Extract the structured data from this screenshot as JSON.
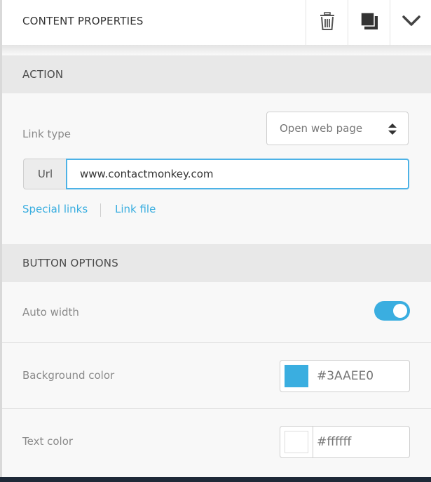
{
  "header": {
    "title": "CONTENT PROPERTIES",
    "icons": [
      "trash-icon",
      "duplicate-icon",
      "chevron-down-icon"
    ]
  },
  "action": {
    "section_title": "ACTION",
    "link_type_label": "Link type",
    "link_type_value": "Open web page",
    "url_addon": "Url",
    "url_value": "www.contactmonkey.com",
    "special_links": "Special links",
    "link_file": "Link file"
  },
  "button_options": {
    "section_title": "BUTTON OPTIONS",
    "auto_width_label": "Auto width",
    "auto_width_on": true,
    "background_color_label": "Background color",
    "background_color_value": "#3AAEE0",
    "background_color_swatch": "#3AAEE0",
    "text_color_label": "Text color",
    "text_color_value": "#ffffff",
    "text_color_swatch": "#ffffff"
  },
  "colors": {
    "accent": "#3AAEE0",
    "section_bg": "#e8e8e8"
  }
}
